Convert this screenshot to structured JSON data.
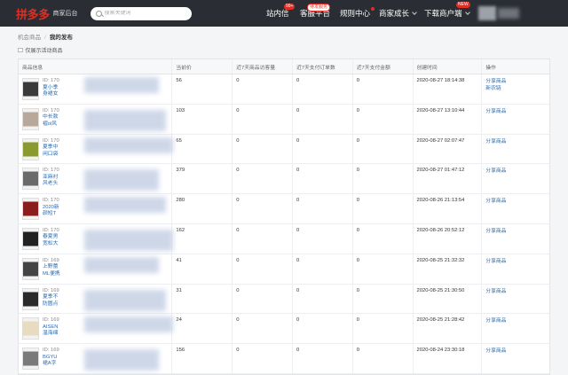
{
  "topbar": {
    "logo_text": "拼多多",
    "logo_sub": "商家后台",
    "search_placeholder": "搜索关键词",
    "nav": [
      {
        "label": "站内信",
        "badge": "99+"
      },
      {
        "label": "客服平台",
        "badge": "待发服务"
      },
      {
        "label": "规则中心"
      },
      {
        "label": "商家成长"
      },
      {
        "label": "下载商户端",
        "badge": "NEW"
      }
    ]
  },
  "breadcrumb": {
    "parent": "机会商品",
    "current": "我的发布"
  },
  "filter": {
    "label": "仅展示活动商品"
  },
  "table": {
    "headers": [
      "商品信息",
      "当前价",
      "近7天商品访客量",
      "近7天支付订单数",
      "近7天支付金额",
      "创建时间",
      "操作"
    ],
    "rows": [
      {
        "id": "ID: 170",
        "name1": "夏小季",
        "name2": "身裙女",
        "price": "56",
        "visitors": "0",
        "orders": "0",
        "amount": "0",
        "created": "2020-08-27 18:14:38",
        "actions": [
          "分享商品",
          "新农链"
        ],
        "thumb_color": "#3a3a3a"
      },
      {
        "id": "ID: 170",
        "name1": "中长款",
        "name2": "褶ol风",
        "price": "103",
        "visitors": "0",
        "orders": "0",
        "amount": "0",
        "created": "2020-08-27 13:10:44",
        "actions": [
          "分享商品"
        ],
        "thumb_color": "#b8a89a"
      },
      {
        "id": "ID: 170",
        "name1": "夏季中",
        "name2": "闲口袋",
        "price": "65",
        "visitors": "0",
        "orders": "0",
        "amount": "0",
        "created": "2020-08-27 02:07:47",
        "actions": [
          "分享商品"
        ],
        "thumb_color": "#8a9a2e"
      },
      {
        "id": "ID: 170",
        "name1": "亚麻衬",
        "name2": "风老头",
        "price": "379",
        "visitors": "0",
        "orders": "0",
        "amount": "0",
        "created": "2020-08-27 01:47:12",
        "actions": [
          "分享商品"
        ],
        "thumb_color": "#6a6a6a"
      },
      {
        "id": "ID: 170",
        "name1": "2020新",
        "name2": "颜短T",
        "price": "280",
        "visitors": "0",
        "orders": "0",
        "amount": "0",
        "created": "2020-08-26 21:13:54",
        "actions": [
          "分享商品"
        ],
        "thumb_color": "#8a1e1e"
      },
      {
        "id": "ID: 170",
        "name1": "春夏男",
        "name2": "宽松大",
        "price": "162",
        "visitors": "0",
        "orders": "0",
        "amount": "0",
        "created": "2020-08-26 20:52:12",
        "actions": [
          "分享商品"
        ],
        "thumb_color": "#222222"
      },
      {
        "id": "ID: 169",
        "name1": "上野蕾",
        "name2": "ML便携",
        "price": "41",
        "visitors": "0",
        "orders": "0",
        "amount": "0",
        "created": "2020-08-25 21:32:32",
        "actions": [
          "分享商品"
        ],
        "thumb_color": "#444444"
      },
      {
        "id": "ID: 169",
        "name1": "夏季不",
        "name2": "防圆点",
        "price": "31",
        "visitors": "0",
        "orders": "0",
        "amount": "0",
        "created": "2020-08-25 21:30:50",
        "actions": [
          "分享商品"
        ],
        "thumb_color": "#2a2a2a"
      },
      {
        "id": "ID: 169",
        "name1": "AISEN",
        "name2": "温海绵",
        "price": "24",
        "visitors": "0",
        "orders": "0",
        "amount": "0",
        "created": "2020-08-25 21:28:42",
        "actions": [
          "分享商品"
        ],
        "thumb_color": "#e8dcc0"
      },
      {
        "id": "ID: 169",
        "name1": "BGYU",
        "name2": "裙A字",
        "price": "156",
        "visitors": "0",
        "orders": "0",
        "amount": "0",
        "created": "2020-08-24 23:30:18",
        "actions": [
          "分享商品"
        ],
        "thumb_color": "#7a7a7a"
      }
    ]
  },
  "colors": {
    "topbar": "#2a2d33",
    "brand": "#e02e24",
    "link": "#2b6cb0"
  }
}
